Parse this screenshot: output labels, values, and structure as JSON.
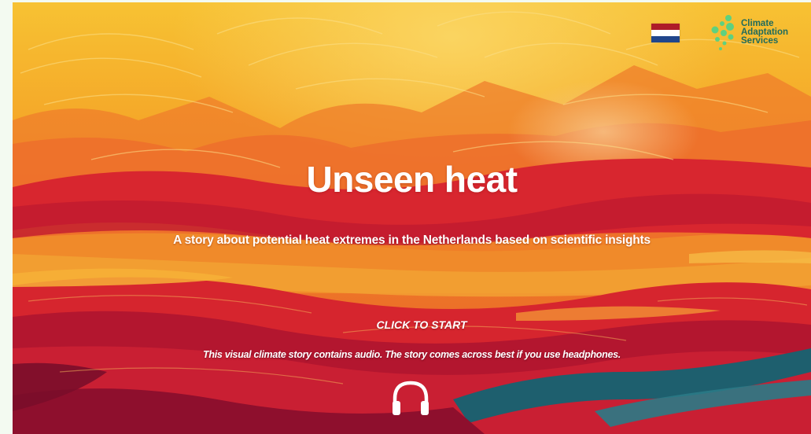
{
  "header": {
    "language_flag": {
      "icon": "netherlands-flag-icon",
      "colors": [
        "#ae1c28",
        "#ffffff",
        "#21468b"
      ]
    },
    "logo": {
      "lines": [
        "Climate",
        "Adaptation",
        "Services"
      ],
      "color": "#1f6b5c",
      "accent": "#5fd17f"
    }
  },
  "hero": {
    "title": "Unseen heat",
    "subtitle": "A story about potential heat extremes in the Netherlands based on scientific insights",
    "start_label": "CLICK TO START",
    "audio_note": "This visual climate story contains audio. The story comes across best if you use headphones.",
    "audio_icon": "headphones-icon"
  },
  "palette": {
    "sky": "#f6b12a",
    "orange": "#f0702a",
    "red": "#d21f32",
    "crimson": "#9b1030",
    "teal": "#1e5f6e"
  }
}
